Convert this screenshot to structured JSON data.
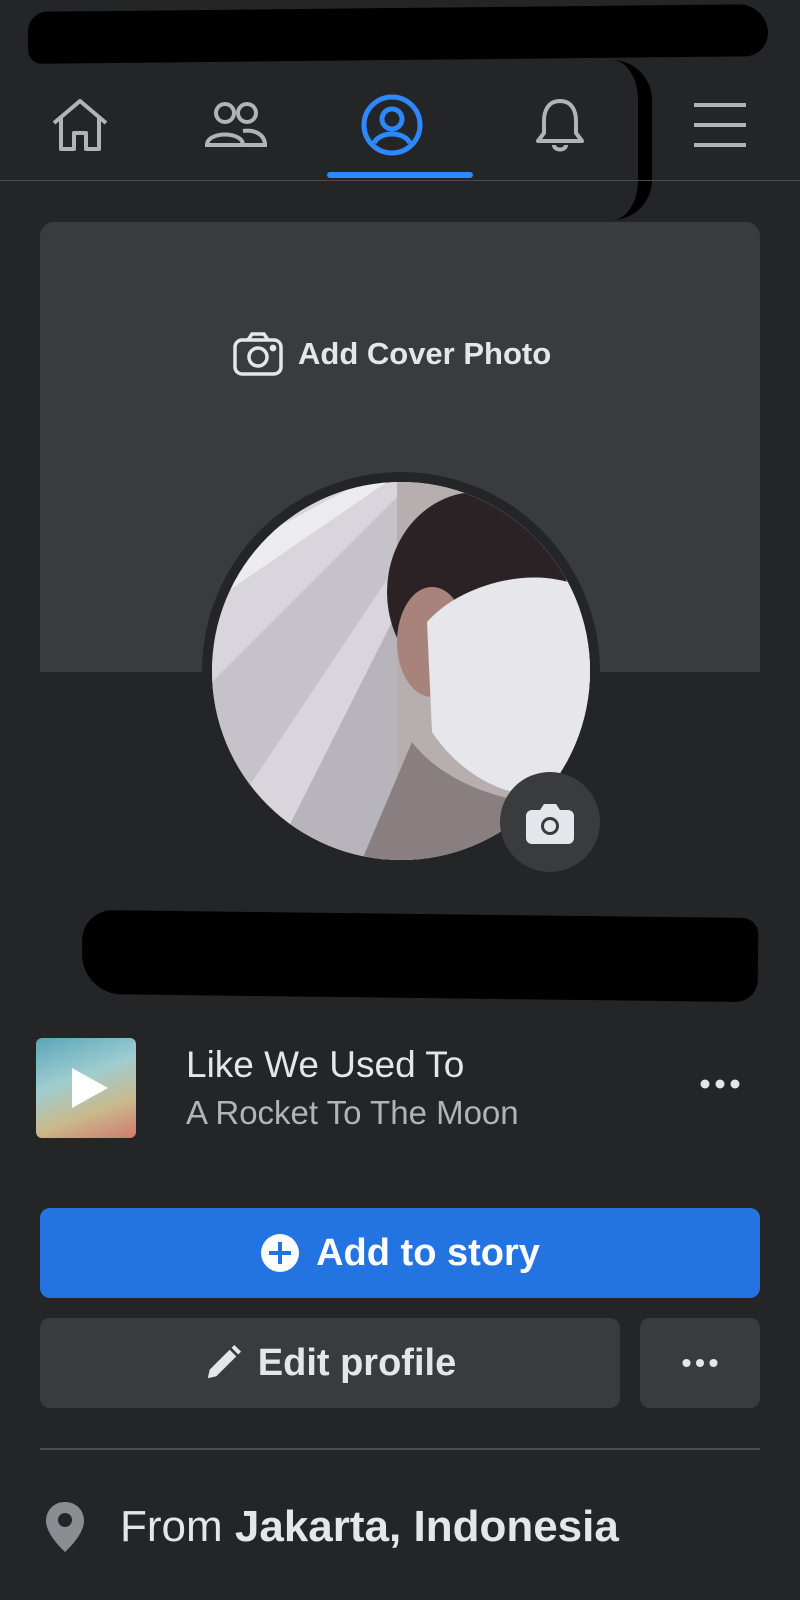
{
  "nav": {
    "items": [
      {
        "name": "home"
      },
      {
        "name": "friends"
      },
      {
        "name": "profile"
      },
      {
        "name": "notifications"
      },
      {
        "name": "menu"
      }
    ],
    "active": "profile"
  },
  "cover": {
    "add_label": "Add Cover Photo"
  },
  "music": {
    "title": "Like We Used To",
    "artist": "A Rocket To The Moon"
  },
  "actions": {
    "add_story_label": "Add to story",
    "edit_profile_label": "Edit profile"
  },
  "intro": {
    "from_prefix": "From",
    "from_location": "Jakarta, Indonesia"
  },
  "colors": {
    "background": "#242526",
    "surface": "#3a3b3c",
    "accent": "#2374e1",
    "active_tab": "#2d88ff",
    "text_primary": "#e4e6eb",
    "text_secondary": "#b0b3b8"
  }
}
